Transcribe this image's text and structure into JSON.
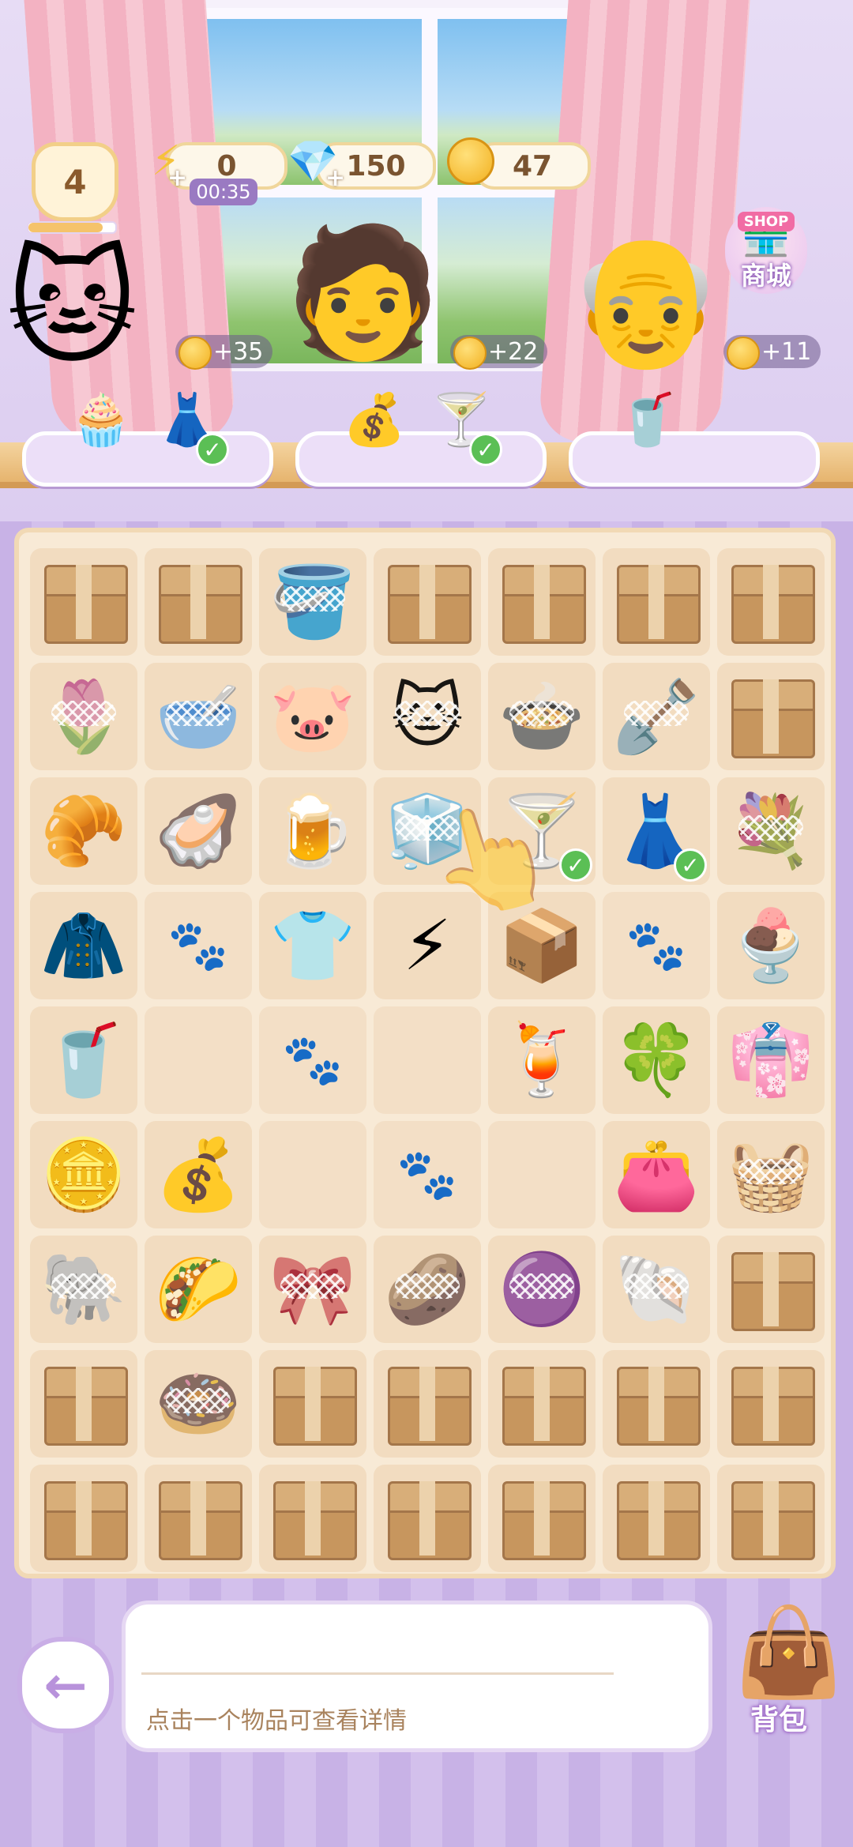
{
  "hud": {
    "level": "4",
    "xp_fraction": 0.85,
    "energy": {
      "value": "0",
      "timer": "00:35",
      "icon": "lightning-icon"
    },
    "gems": {
      "value": "150",
      "icon": "gem-icon"
    },
    "coins": {
      "value": "47",
      "icon": "coin-icon"
    },
    "shop": {
      "tag": "SHOP",
      "label": "商城"
    }
  },
  "customers": [
    {
      "name": "cat-witch",
      "reward": "+35",
      "items": [
        "🧁",
        "👗"
      ],
      "items_done": [
        false,
        true
      ]
    },
    {
      "name": "dark-haired-boy",
      "reward": "+22",
      "items": [
        "💰",
        "🍸"
      ],
      "items_done": [
        false,
        true
      ]
    },
    {
      "name": "silver-haired-man",
      "reward": "+11",
      "items": [
        "🥤"
      ],
      "items_done": [
        false
      ]
    }
  ],
  "board": {
    "rows": [
      [
        {
          "t": "box"
        },
        {
          "t": "box"
        },
        {
          "t": "item",
          "g": "🪣",
          "web": true
        },
        {
          "t": "box"
        },
        {
          "t": "box"
        },
        {
          "t": "box"
        },
        {
          "t": "box"
        }
      ],
      [
        {
          "t": "item",
          "g": "🌷",
          "web": true
        },
        {
          "t": "item",
          "g": "🥣",
          "web": true
        },
        {
          "t": "item",
          "g": "🐷"
        },
        {
          "t": "item",
          "g": "🐱",
          "web": true
        },
        {
          "t": "item",
          "g": "🍲",
          "web": true
        },
        {
          "t": "item",
          "g": "🪏",
          "web": true
        },
        {
          "t": "box"
        }
      ],
      [
        {
          "t": "item",
          "g": "🥐"
        },
        {
          "t": "item",
          "g": "🦪"
        },
        {
          "t": "item",
          "g": "🍺"
        },
        {
          "t": "item",
          "g": "🧊",
          "web": true
        },
        {
          "t": "item",
          "g": "🍸",
          "check": true
        },
        {
          "t": "item",
          "g": "👗",
          "check": true
        },
        {
          "t": "item",
          "g": "💐",
          "web": true
        }
      ],
      [
        {
          "t": "item",
          "g": "🧥"
        },
        {
          "t": "paw"
        },
        {
          "t": "item",
          "g": "👕"
        },
        {
          "t": "item",
          "g": "⚡"
        },
        {
          "t": "item",
          "g": "📦"
        },
        {
          "t": "paw"
        },
        {
          "t": "item",
          "g": "🍨"
        }
      ],
      [
        {
          "t": "item",
          "g": "🥤"
        },
        {
          "t": "empty"
        },
        {
          "t": "paw"
        },
        {
          "t": "empty"
        },
        {
          "t": "item",
          "g": "🍹"
        },
        {
          "t": "item",
          "g": "🍀"
        },
        {
          "t": "item",
          "g": "👘"
        }
      ],
      [
        {
          "t": "item",
          "g": "🪙"
        },
        {
          "t": "item",
          "g": "💰"
        },
        {
          "t": "empty"
        },
        {
          "t": "paw"
        },
        {
          "t": "empty"
        },
        {
          "t": "item",
          "g": "👛"
        },
        {
          "t": "item",
          "g": "🧺",
          "web": true
        }
      ],
      [
        {
          "t": "item",
          "g": "🐘",
          "web": true
        },
        {
          "t": "item",
          "g": "🌮"
        },
        {
          "t": "item",
          "g": "🎀",
          "web": true
        },
        {
          "t": "item",
          "g": "🥔",
          "web": true
        },
        {
          "t": "item",
          "g": "🟣",
          "web": true
        },
        {
          "t": "item",
          "g": "🐚",
          "web": true
        },
        {
          "t": "box"
        }
      ],
      [
        {
          "t": "box"
        },
        {
          "t": "item",
          "g": "🍩",
          "web": true
        },
        {
          "t": "box"
        },
        {
          "t": "box"
        },
        {
          "t": "box"
        },
        {
          "t": "box"
        },
        {
          "t": "box"
        }
      ],
      [
        {
          "t": "box"
        },
        {
          "t": "box"
        },
        {
          "t": "box"
        },
        {
          "t": "box"
        },
        {
          "t": "box"
        },
        {
          "t": "box"
        },
        {
          "t": "box"
        }
      ]
    ]
  },
  "bottom": {
    "hint": "点击一个物品可查看详情",
    "bag_label": "背包",
    "back_icon": "back-arrow-icon"
  },
  "colors": {
    "accent": "#c9aee6",
    "board": "#f8ead6",
    "coin": "#f2b01f"
  }
}
